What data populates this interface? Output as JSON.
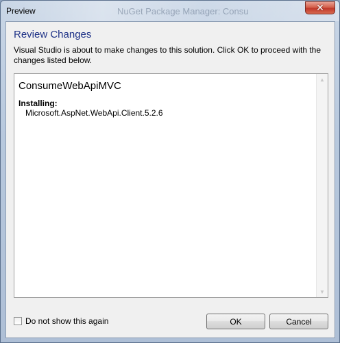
{
  "window": {
    "title": "Preview",
    "background_title": "NuGet Package Manager: Consu",
    "close_glyph": "✕"
  },
  "dialog": {
    "heading": "Review Changes",
    "description": "Visual Studio is about to make changes to this solution. Click OK to proceed with the changes listed below."
  },
  "changes": {
    "project": "ConsumeWebApiMVC",
    "section_label": "Installing:",
    "packages": [
      "Microsoft.AspNet.WebApi.Client.5.2.6"
    ]
  },
  "footer": {
    "checkbox_label": "Do not show this again",
    "checkbox_checked": false,
    "ok_label": "OK",
    "cancel_label": "Cancel"
  },
  "colors": {
    "heading": "#1e3287",
    "close_button": "#c0392b"
  }
}
